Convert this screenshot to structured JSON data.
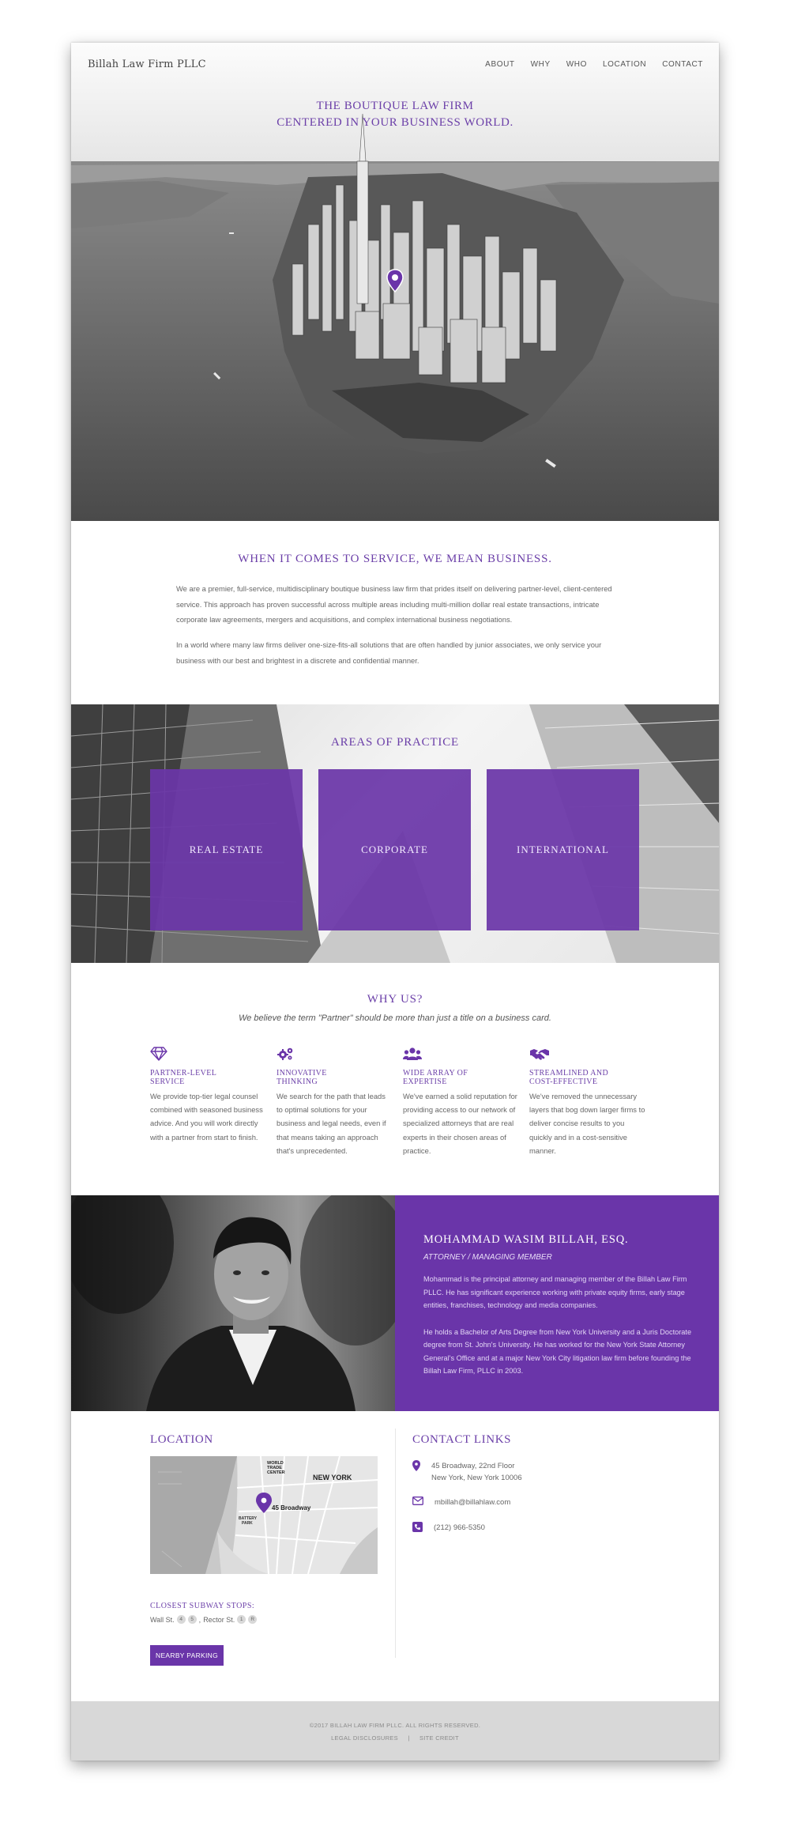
{
  "header": {
    "brand": "Billah Law Firm PLLC",
    "nav": [
      "ABOUT",
      "WHY",
      "WHO",
      "LOCATION",
      "CONTACT"
    ]
  },
  "hero": {
    "title_line1": "The Boutique Law Firm",
    "title_line2": "Centered in Your Business World."
  },
  "service": {
    "title": "When it comes to service, we mean business.",
    "paragraph1": "We are a premier, full-service, multidisciplinary boutique business law firm that prides itself on delivering partner-level, client-centered service. This approach has proven successful across multiple areas including multi-million dollar real estate transactions, intricate corporate law agreements, mergers and acquisitions, and complex international business negotiations.",
    "paragraph2": "In a world where many law firms deliver one-size-fits-all solutions that are often handled by junior associates, we only service your business with our best and brightest in a discrete and confidential manner."
  },
  "practice": {
    "title": "Areas of Practice",
    "areas": [
      "Real Estate",
      "Corporate",
      "International"
    ]
  },
  "why": {
    "title": "Why Us?",
    "tagline": "We believe the term \"Partner\" should be more than just a title on a business card.",
    "features": [
      {
        "icon": "diamond-icon",
        "title_line1": "Partner-Level",
        "title_line2": "Service",
        "text": "We provide top-tier legal counsel combined with seasoned business advice. And you will work directly with a partner from start to finish."
      },
      {
        "icon": "gears-icon",
        "title_line1": "Innovative",
        "title_line2": "Thinking",
        "text": "We search for the path that leads to optimal solutions for your business and legal needs, even if that means taking an approach that's unprecedented."
      },
      {
        "icon": "users-icon",
        "title_line1": "Wide Array of",
        "title_line2": "Expertise",
        "text": "We've earned a solid reputation for providing access to our network of specialized attorneys that are real experts in their chosen areas of practice."
      },
      {
        "icon": "handshake-icon",
        "title_line1": "Streamlined and",
        "title_line2": "Cost-Effective",
        "text": "We've removed the unnecessary layers that bog down larger firms to deliver concise results to you quickly and in a cost-sensitive manner."
      }
    ]
  },
  "bio": {
    "name": "Mohammad Wasim Billah, Esq.",
    "role": "Attorney / Managing Member",
    "paragraph1": "Mohammad is the principal attorney and managing member of the Billah Law Firm PLLC. He has significant experience working with private equity firms, early stage entities, franchises, technology and media companies.",
    "paragraph2": "He holds a Bachelor of Arts Degree from New York University and a Juris Doctorate degree from St. John's University. He has worked for the New York State Attorney General's Office and at a major New York City litigation law firm before founding the Billah Law Firm, PLLC in 2003."
  },
  "location": {
    "title": "Location",
    "map_labels": {
      "wtc_line1": "WORLD",
      "wtc_line2": "TRADE",
      "wtc_line3": "CENTER",
      "new_york": "NEW YORK",
      "address": "45 Broadway",
      "battery_line1": "BATTERY",
      "battery_line2": "PARK"
    },
    "subway_title": "Closest Subway Stops:",
    "wall_st": "Wall St.",
    "wall_st_lines": [
      "4",
      "5"
    ],
    "separator": ",",
    "rector_st": "Rector St.",
    "rector_st_lines": [
      "1",
      "R"
    ],
    "parking_button": "Nearby Parking"
  },
  "contact": {
    "title": "Contact Links",
    "address_line1": "45 Broadway, 22nd Floor",
    "address_line2": "New York, New York 10006",
    "email": "mbillah@billahlaw.com",
    "phone": "(212) 966-5350"
  },
  "footer": {
    "copyright": "©2017 Billah Law Firm PLLC. All Rights Reserved.",
    "legal": "Legal Disclosures",
    "separator": "|",
    "credit": "Site Credit"
  },
  "colors": {
    "accent": "#6a35a9",
    "footer_bg": "#d8d8d8"
  }
}
